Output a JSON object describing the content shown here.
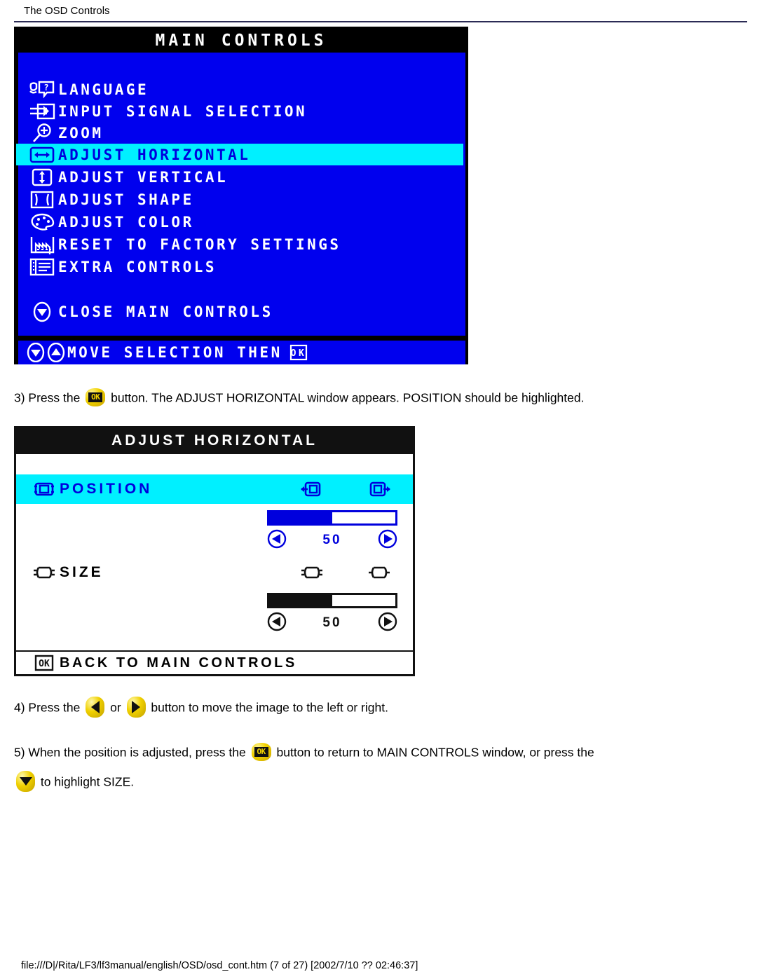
{
  "header": {
    "title": "The OSD Controls"
  },
  "main_controls": {
    "window_title": "MAIN CONTROLS",
    "items": [
      {
        "icon": "language-icon",
        "label": "LANGUAGE",
        "highlighted": false
      },
      {
        "icon": "input-signal-icon",
        "label": "INPUT SIGNAL SELECTION",
        "highlighted": false
      },
      {
        "icon": "zoom-magnifier-icon",
        "label": "ZOOM",
        "highlighted": false
      },
      {
        "icon": "adjust-horizontal-icon",
        "label": "ADJUST HORIZONTAL",
        "highlighted": true
      },
      {
        "icon": "adjust-vertical-icon",
        "label": "ADJUST VERTICAL",
        "highlighted": false
      },
      {
        "icon": "adjust-shape-icon",
        "label": "ADJUST SHAPE",
        "highlighted": false
      },
      {
        "icon": "adjust-color-icon",
        "label": "ADJUST COLOR",
        "highlighted": false
      },
      {
        "icon": "factory-reset-icon",
        "label": "RESET TO FACTORY SETTINGS",
        "highlighted": false
      },
      {
        "icon": "extra-controls-icon",
        "label": "EXTRA CONTROLS",
        "highlighted": false
      }
    ],
    "close_item": {
      "icon": "arrow-down-circle-icon",
      "label": "CLOSE MAIN CONTROLS"
    },
    "footer": {
      "icons": [
        "arrow-down-circle-icon",
        "arrow-up-circle-icon"
      ],
      "label": "MOVE SELECTION THEN",
      "trailing_icon": "ok-box-icon",
      "trailing_icon_text": "OK"
    },
    "colors": {
      "background": "#0000ee",
      "highlight": "#00f0ff",
      "title_bar": "#000000",
      "text": "#ffffff",
      "highlight_text": "#0000dd"
    }
  },
  "steps": {
    "step3": {
      "before": "3) Press the",
      "button_icon": "ok-button-icon",
      "button_text": "OK",
      "after": "button. The ADJUST HORIZONTAL window appears. POSITION should be highlighted."
    },
    "step4": {
      "before": "4) Press the",
      "left_icon": "arrow-left-button-icon",
      "middle": "or",
      "right_icon": "arrow-right-button-icon",
      "after": "button to move the image to the left or right."
    },
    "step5": {
      "before": "5) When the position is adjusted, press the",
      "button_icon": "ok-button-icon",
      "button_text": "OK",
      "middle": "button to return to MAIN CONTROLS window, or press the",
      "down_icon": "arrow-down-button-icon",
      "after": "to highlight SIZE."
    }
  },
  "adjust_horizontal": {
    "window_title": "ADJUST HORIZONTAL",
    "rows": [
      {
        "icon": "position-icon",
        "label": "POSITION",
        "highlighted": true,
        "left_adjust_icon": "position-left-icon",
        "right_adjust_icon": "position-right-icon",
        "value": "50",
        "fill_percent": 50,
        "dec_icon": "arrow-left-circle-icon",
        "inc_icon": "arrow-right-circle-icon"
      },
      {
        "icon": "size-icon",
        "label": "SIZE",
        "highlighted": false,
        "left_adjust_icon": "size-narrow-icon",
        "right_adjust_icon": "size-wide-icon",
        "value": "50",
        "fill_percent": 50,
        "dec_icon": "arrow-left-circle-icon",
        "inc_icon": "arrow-right-circle-icon"
      }
    ],
    "footer": {
      "icon": "ok-box-icon",
      "icon_text": "OK",
      "label": "BACK TO MAIN CONTROLS"
    },
    "colors": {
      "background": "#ffffff",
      "highlight": "#00f0ff",
      "title_bar": "#111111",
      "accent": "#0000dd"
    }
  },
  "footer": {
    "path": "file:///D|/Rita/LF3/lf3manual/english/OSD/osd_cont.htm (7 of 27) [2002/7/10 ?? 02:46:37]"
  }
}
